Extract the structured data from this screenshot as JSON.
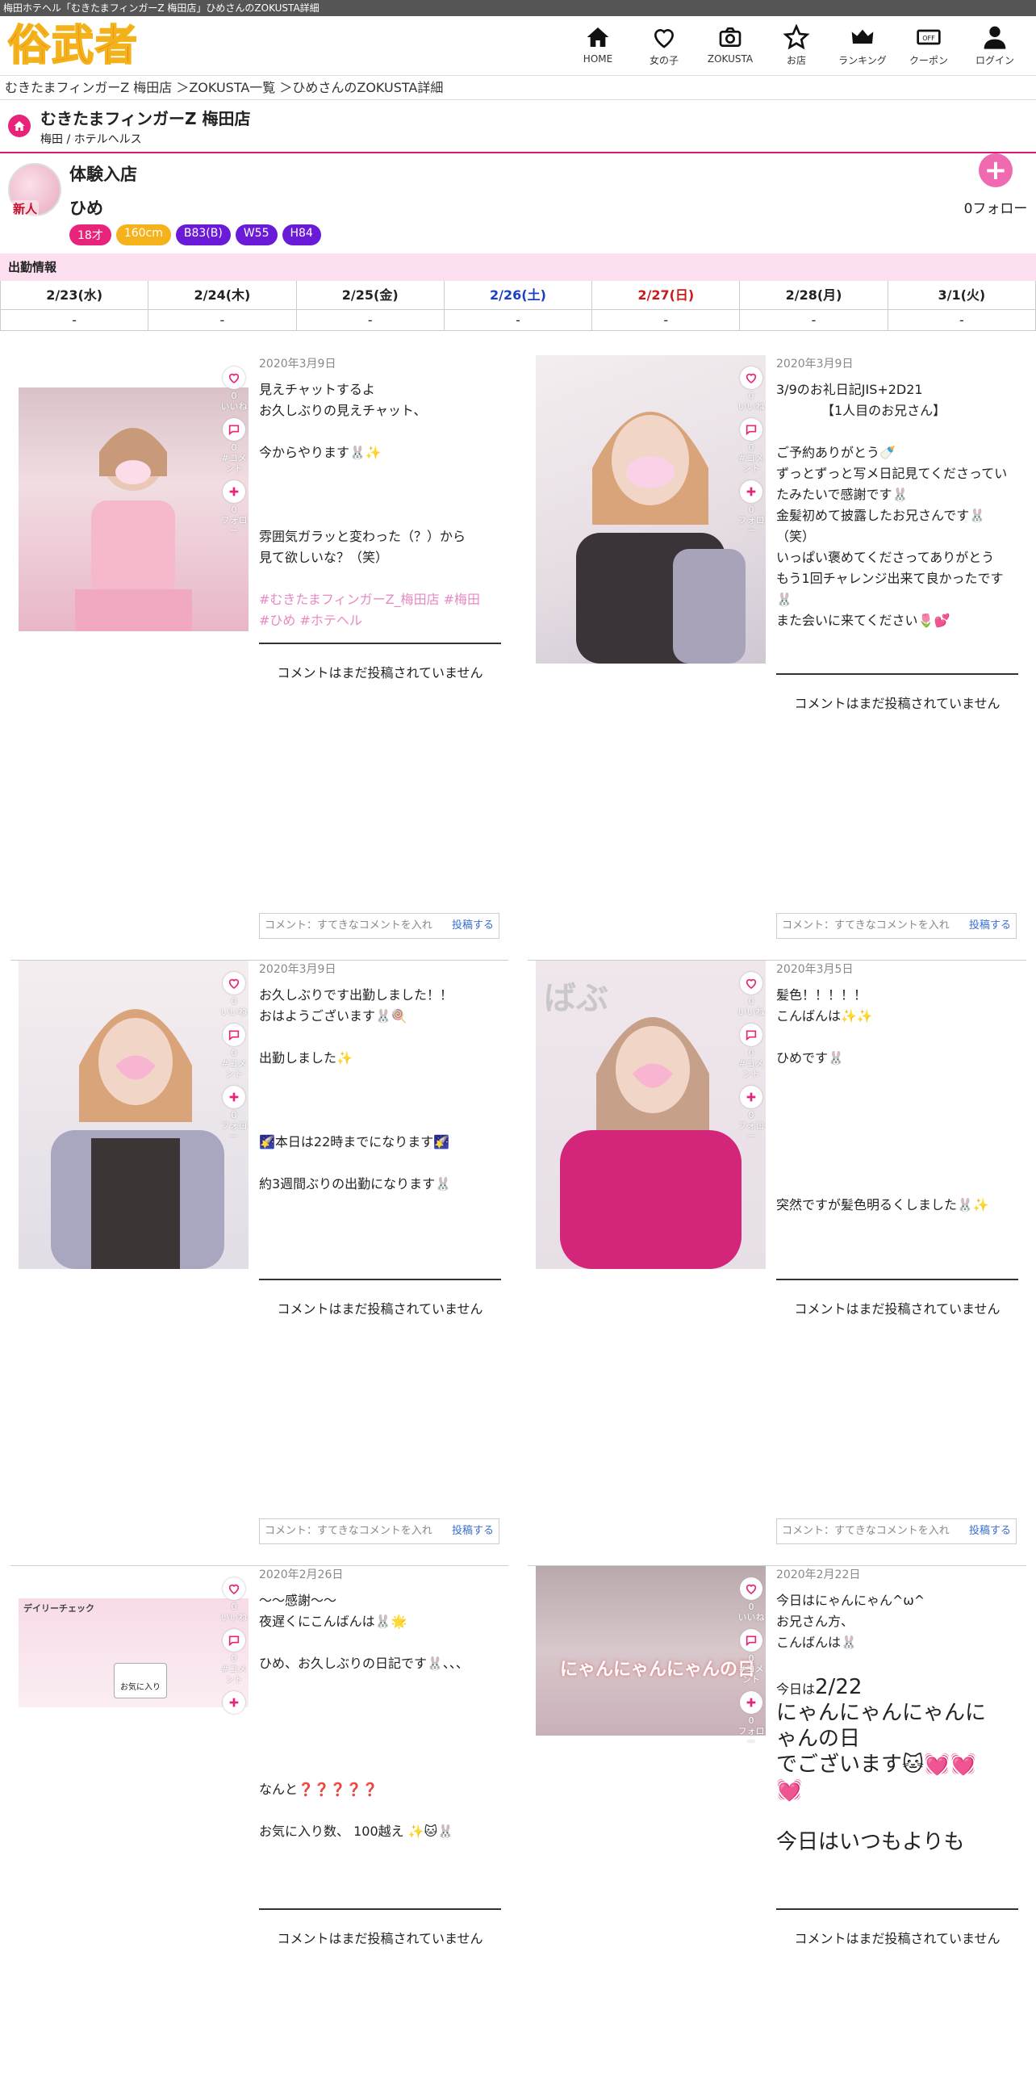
{
  "browser_title": "梅田ホテヘル「むきたまフィンガーZ 梅田店」ひめさんのZOKUSTA詳細",
  "logo": "俗武者",
  "nav": [
    {
      "label": "HOME",
      "icon": "home-icon"
    },
    {
      "label": "女の子",
      "icon": "heart-icon"
    },
    {
      "label": "ZOKUSTA",
      "icon": "camera-icon"
    },
    {
      "label": "お店",
      "icon": "star-icon"
    },
    {
      "label": "ランキング",
      "icon": "crown-icon"
    },
    {
      "label": "クーポン",
      "icon": "coupon-icon"
    },
    {
      "label": "ログイン",
      "icon": "user-icon"
    }
  ],
  "breadcrumb": "むきたまフィンガーZ 梅田店 ＞ZOKUSTA一覧 ＞ひめさんのZOKUSTA詳細",
  "shop": {
    "name": "むきたまフィンガーZ 梅田店",
    "area": "梅田 / ホテルヘルス"
  },
  "profile": {
    "type": "体験入店",
    "name": "ひめ",
    "new_badge": "新人",
    "tags": [
      {
        "text": "18才",
        "color": "#e8237a"
      },
      {
        "text": "160cm",
        "color": "#f6b21b"
      },
      {
        "text": "B83(B)",
        "color": "#6a1bd8"
      },
      {
        "text": "W55",
        "color": "#6a1bd8"
      },
      {
        "text": "H84",
        "color": "#6a1bd8"
      }
    ],
    "follow_count": "0フォロー"
  },
  "schedule": {
    "title": "出勤情報",
    "days": [
      {
        "date": "2/23(水)",
        "val": "-"
      },
      {
        "date": "2/24(木)",
        "val": "-"
      },
      {
        "date": "2/25(金)",
        "val": "-"
      },
      {
        "date": "2/26(土)",
        "val": "-"
      },
      {
        "date": "2/27(日)",
        "val": "-"
      },
      {
        "date": "2/28(月)",
        "val": "-"
      },
      {
        "date": "3/1(火)",
        "val": "-"
      }
    ]
  },
  "icon_labels": {
    "like": "いいね",
    "comment": "#コメント",
    "follow": "フォロー",
    "zero": "0"
  },
  "posts": [
    {
      "date": "2020年3月9日",
      "body": "見えチャットするよ\nお久しぶりの見えチャット、\n\n今からやります🐰✨\n\n\n\n雰囲気ガラッと変わった（？）から\n見て欲しいな？（笑）\n\n",
      "hashtags": "#むきたまフィンガーZ_梅田店 #梅田\n#ひめ #ホテヘル"
    },
    {
      "date": "2020年3月9日",
      "body": "3/9のお礼日記JIS+2D21\n　　　　【1人目のお兄さん】\n\nご予約ありがとう🍼\nずっとずっと写メ日記見てくださってい\nたみたいで感謝です🐰\n金髪初めて披露したお兄さんです🐰\n（笑）\nいっぱい褒めてくださってありがとう\nもう1回チャレンジ出来て良かったです\n🐰\nまた会いに来てください🌷💕",
      "hashtags": ""
    },
    {
      "date": "2020年3月9日",
      "body": "お久しぶりです出勤しました！！\nおはようございます🐰🍭\n\n出勤しました✨\n\n\n\n🌠本日は22時までになります🌠\n\n約3週間ぶりの出勤になります🐰",
      "hashtags": ""
    },
    {
      "date": "2020年3月5日",
      "body": "髪色！！！！！\nこんばんは✨✨\n\nひめです🐰\n\n\n\n\n\n\n突然ですが髪色明るくしました🐰✨",
      "hashtags": ""
    },
    {
      "date": "2020年2月26日",
      "body": "〜〜感謝〜〜\n夜遅くにこんばんは🐰🌟\n\nひめ、お久しぶりの日記です🐰、、、\n\n\n\n\n\nなんと❓❓❓❓❓\n\nお気に入り数、 100越え ✨🐱🐰",
      "hashtags": ""
    },
    {
      "date": "2020年2月22日",
      "body": "今日はにゃんにゃん^ω^\nお兄さん方、\nこんばんは🐰\n\n今日は",
      "big": "2/22\nにゃんにゃんにゃんに\nゃんの日\nでございます🐱💓💓\n💓\n\n今日はいつもよりも",
      "hashtags": ""
    }
  ],
  "no_comment": "コメントはまだ投稿されていません",
  "comment_placeholder": "コメント：すてきなコメントを入れ",
  "comment_submit": "投稿する",
  "photo_texts": {
    "daily_check": "デイリーチェック",
    "fav": "お気に入り",
    "nyan": "にゃんにゃんにゃんの日"
  }
}
